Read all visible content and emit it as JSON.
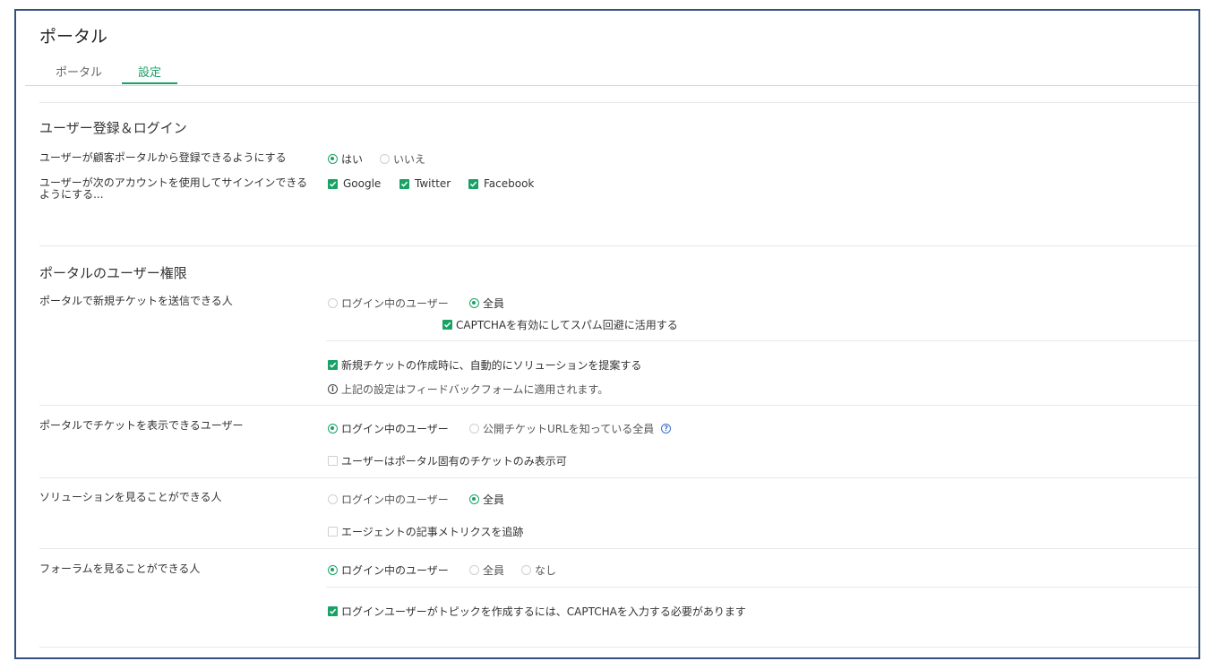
{
  "page": {
    "title": "ポータル"
  },
  "tabs": [
    {
      "label": "ポータル",
      "active": false
    },
    {
      "label": "設定",
      "active": true
    }
  ],
  "colors": {
    "accent": "#1aa266",
    "frame": "#34507e",
    "help": "#3d6fd6"
  },
  "registration": {
    "title": "ユーザー登録＆ログイン",
    "allow_signup": {
      "label": "ユーザーが顧客ポータルから登録できるようにする",
      "options": [
        {
          "label": "はい",
          "selected": true
        },
        {
          "label": "いいえ",
          "selected": false
        }
      ]
    },
    "signin": {
      "label_line1": "ユーザーが次のアカウントを使用してサインインできる",
      "label_line2": "ようにする...",
      "options": [
        {
          "label": "Google",
          "checked": true
        },
        {
          "label": "Twitter",
          "checked": true
        },
        {
          "label": "Facebook",
          "checked": true
        }
      ]
    }
  },
  "permissions": {
    "title": "ポータルのユーザー権限",
    "submit_ticket": {
      "label": "ポータルで新規チケットを送信できる人",
      "options": [
        {
          "label": "ログイン中のユーザー",
          "selected": false
        },
        {
          "label": "全員",
          "selected": true
        }
      ],
      "captcha": {
        "label": "CAPTCHAを有効にしてスパム回避に活用する",
        "checked": true
      },
      "suggest": {
        "label": "新規チケットの作成時に、自動的にソリューションを提案する",
        "checked": true
      },
      "note": "上記の設定はフィードバックフォームに適用されます。"
    },
    "view_ticket": {
      "label": "ポータルでチケットを表示できるユーザー",
      "options": [
        {
          "label": "ログイン中のユーザー",
          "selected": true
        },
        {
          "label": "公開チケットURLを知っている全員",
          "selected": false
        }
      ],
      "portal_only": {
        "label": "ユーザーはポータル固有のチケットのみ表示可",
        "checked": false
      }
    },
    "view_solutions": {
      "label": "ソリューションを見ることができる人",
      "options": [
        {
          "label": "ログイン中のユーザー",
          "selected": false
        },
        {
          "label": "全員",
          "selected": true
        }
      ],
      "track_metrics": {
        "label": "エージェントの記事メトリクスを追跡",
        "checked": false
      }
    },
    "view_forums": {
      "label": "フォーラムを見ることができる人",
      "options": [
        {
          "label": "ログイン中のユーザー",
          "selected": true
        },
        {
          "label": "全員",
          "selected": false
        },
        {
          "label": "なし",
          "selected": false
        }
      ],
      "captcha_topic": {
        "label": "ログインユーザーがトピックを作成するには、CAPTCHAを入力する必要があります",
        "checked": true
      }
    }
  }
}
